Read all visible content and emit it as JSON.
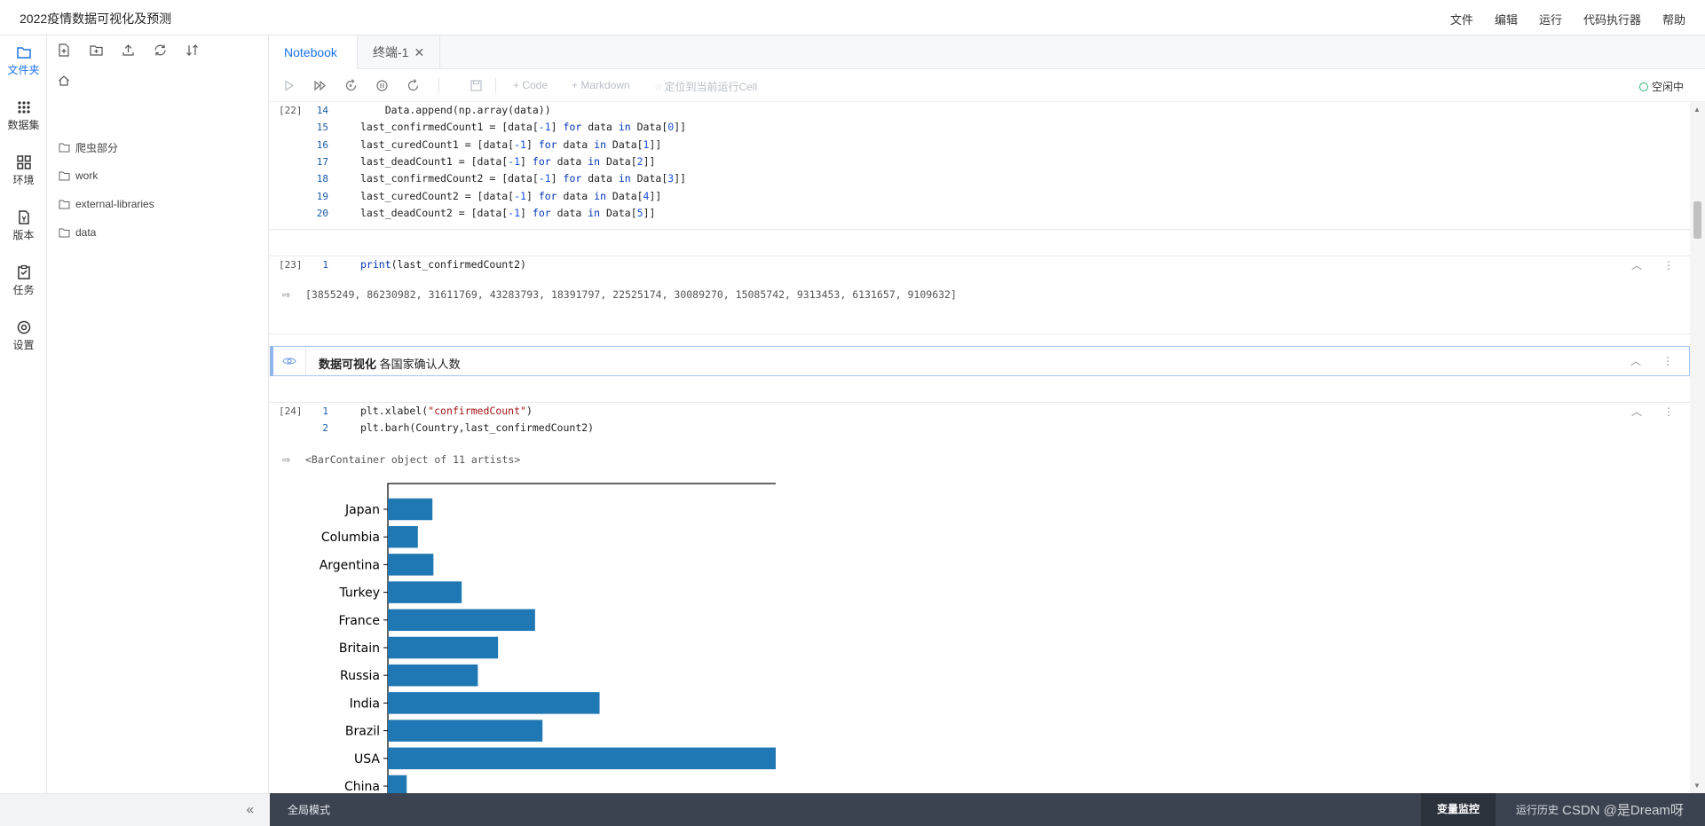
{
  "app": {
    "title": "2022疫情数据可视化及预测"
  },
  "menu": [
    "文件",
    "编辑",
    "运行",
    "代码执行器",
    "帮助"
  ],
  "rail": [
    {
      "label": "文件夹",
      "icon": "folder-icon",
      "active": true
    },
    {
      "label": "数据集",
      "icon": "dataset-icon",
      "active": false
    },
    {
      "label": "环境",
      "icon": "environment-icon",
      "active": false
    },
    {
      "label": "版本",
      "icon": "version-icon",
      "active": false
    },
    {
      "label": "任务",
      "icon": "task-icon",
      "active": false
    },
    {
      "label": "设置",
      "icon": "settings-icon",
      "active": false
    }
  ],
  "files": [
    "爬虫部分",
    "work",
    "external-libraries",
    "data"
  ],
  "tabs": {
    "notebook": "Notebook",
    "terminal": "终端-1"
  },
  "toolbar": {
    "code": "+ Code",
    "markdown": "+ Markdown",
    "locate": "定位到当前运行Cell",
    "kernel_status": "空闲中"
  },
  "cells": {
    "c22": {
      "prompt": "[22]",
      "lines": [
        {
          "n": "14",
          "code": "    Data.append(np.array(data))"
        },
        {
          "n": "15",
          "code": "last_confirmedCount1 = [data[-1] for data in Data[0]]"
        },
        {
          "n": "16",
          "code": "last_curedCount1 = [data[-1] for data in Data[1]]"
        },
        {
          "n": "17",
          "code": "last_deadCount1 = [data[-1] for data in Data[2]]"
        },
        {
          "n": "18",
          "code": "last_confirmedCount2 = [data[-1] for data in Data[3]]"
        },
        {
          "n": "19",
          "code": "last_curedCount2 = [data[-1] for data in Data[4]]"
        },
        {
          "n": "20",
          "code": "last_deadCount2 = [data[-1] for data in Data[5]]"
        }
      ]
    },
    "c23": {
      "prompt": "[23]",
      "line_n": "1",
      "code": "print(last_confirmedCount2)",
      "output": "[3855249, 86230982, 31611769, 43283793, 18391797, 22525174, 30089270, 15085742, 9313453, 6131657, 9109632]"
    },
    "md": {
      "bold": "数据可视化",
      "text": " 各国家确认人数"
    },
    "c24": {
      "prompt": "[24]",
      "lines": [
        {
          "n": "1",
          "code": "plt.xlabel(\"confirmedCount\")"
        },
        {
          "n": "2",
          "code": "plt.barh(Country,last_confirmedCount2)"
        }
      ],
      "output": "<BarContainer object of 11 artists>"
    }
  },
  "chart_data": {
    "type": "bar",
    "orientation": "horizontal",
    "categories": [
      "China",
      "USA",
      "Brazil",
      "India",
      "Russia",
      "Britain",
      "France",
      "Turkey",
      "Argentina",
      "Columbia",
      "Japan"
    ],
    "values": [
      3855249,
      86230982,
      31611769,
      43283793,
      18391797,
      22525174,
      30089270,
      15085742,
      9313453,
      6131657,
      9109632
    ],
    "xlim": [
      0,
      90543531
    ],
    "grid": false,
    "color": "#1f77b4"
  },
  "status": {
    "global_mode": "全局模式",
    "var_monitor": "变量监控",
    "run_history": "运行历史",
    "watermark": "CSDN @是Dream呀"
  }
}
